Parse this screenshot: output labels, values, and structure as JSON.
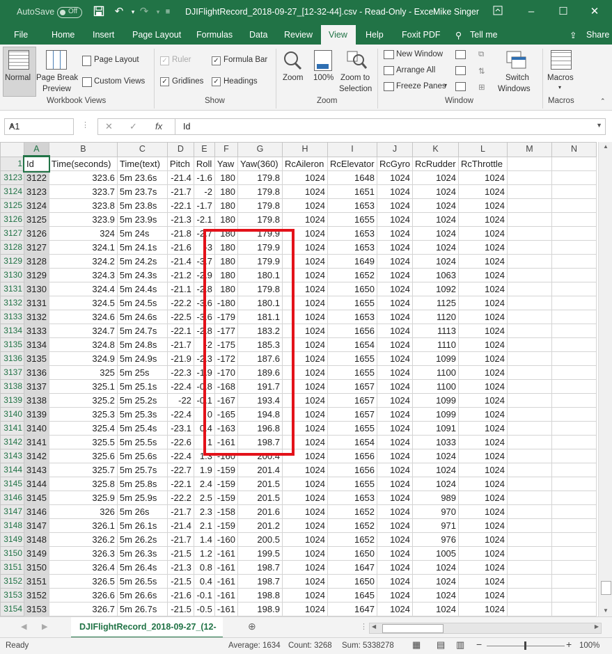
{
  "titlebar": {
    "autosave_label": "AutoSave",
    "autosave_state": "Off",
    "title": "DJIFlightRecord_2018-09-27_[12-32-44].csv  -  Read-Only  -  Excel",
    "user": "Mike Singer"
  },
  "menu": {
    "items": [
      "File",
      "Home",
      "Insert",
      "Page Layout",
      "Formulas",
      "Data",
      "Review",
      "View",
      "Help",
      "Foxit PDF"
    ],
    "tell_me": "Tell me",
    "share": "Share"
  },
  "ribbon": {
    "normal": "Normal",
    "page_break_1": "Page Break",
    "page_break_2": "Preview",
    "page_layout": "Page Layout",
    "custom_views": "Custom Views",
    "group_workbook_views": "Workbook Views",
    "ruler": "Ruler",
    "formula_bar": "Formula Bar",
    "gridlines": "Gridlines",
    "headings": "Headings",
    "group_show": "Show",
    "zoom": "Zoom",
    "zoom100": "100%",
    "zoom_sel_1": "Zoom to",
    "zoom_sel_2": "Selection",
    "group_zoom": "Zoom",
    "new_window": "New Window",
    "arrange_all": "Arrange All",
    "freeze_panes": "Freeze Panes",
    "switch_1": "Switch",
    "switch_2": "Windows",
    "group_window": "Window",
    "macros": "Macros",
    "group_macros": "Macros"
  },
  "formula_bar": {
    "name_box": "A1",
    "fx": "fx",
    "content": "Id"
  },
  "columns": [
    "A",
    "B",
    "C",
    "D",
    "E",
    "F",
    "G",
    "H",
    "I",
    "J",
    "K",
    "L",
    "M",
    "N"
  ],
  "header_row": {
    "row_number": "1",
    "cells": [
      "Id",
      "Time(seconds)",
      "Time(text)",
      "Pitch",
      "Roll",
      "Yaw",
      "Yaw(360)",
      "RcAileron",
      "RcElevator",
      "RcGyro",
      "RcRudder",
      "RcThrottle",
      "",
      ""
    ]
  },
  "rows": [
    [
      "3123",
      "3122",
      "323.6",
      "5m 23.6s",
      "-21.4",
      "-1.6",
      "180",
      "179.8",
      "1024",
      "1648",
      "1024",
      "1024",
      "1024"
    ],
    [
      "3124",
      "3123",
      "323.7",
      "5m 23.7s",
      "-21.7",
      "-2",
      "180",
      "179.8",
      "1024",
      "1651",
      "1024",
      "1024",
      "1024"
    ],
    [
      "3125",
      "3124",
      "323.8",
      "5m 23.8s",
      "-22.1",
      "-1.7",
      "180",
      "179.8",
      "1024",
      "1653",
      "1024",
      "1024",
      "1024"
    ],
    [
      "3126",
      "3125",
      "323.9",
      "5m 23.9s",
      "-21.3",
      "-2.1",
      "180",
      "179.8",
      "1024",
      "1655",
      "1024",
      "1024",
      "1024"
    ],
    [
      "3127",
      "3126",
      "324",
      "5m 24s",
      "-21.8",
      "-2.7",
      "180",
      "179.9",
      "1024",
      "1653",
      "1024",
      "1024",
      "1024"
    ],
    [
      "3128",
      "3127",
      "324.1",
      "5m 24.1s",
      "-21.6",
      "-3",
      "180",
      "179.9",
      "1024",
      "1653",
      "1024",
      "1024",
      "1024"
    ],
    [
      "3129",
      "3128",
      "324.2",
      "5m 24.2s",
      "-21.4",
      "-3.7",
      "180",
      "179.9",
      "1024",
      "1649",
      "1024",
      "1024",
      "1024"
    ],
    [
      "3130",
      "3129",
      "324.3",
      "5m 24.3s",
      "-21.2",
      "-2.9",
      "180",
      "180.1",
      "1024",
      "1652",
      "1024",
      "1063",
      "1024"
    ],
    [
      "3131",
      "3130",
      "324.4",
      "5m 24.4s",
      "-21.1",
      "-2.8",
      "180",
      "179.8",
      "1024",
      "1650",
      "1024",
      "1092",
      "1024"
    ],
    [
      "3132",
      "3131",
      "324.5",
      "5m 24.5s",
      "-22.2",
      "-3.6",
      "-180",
      "180.1",
      "1024",
      "1655",
      "1024",
      "1125",
      "1024"
    ],
    [
      "3133",
      "3132",
      "324.6",
      "5m 24.6s",
      "-22.5",
      "-3.6",
      "-179",
      "181.1",
      "1024",
      "1653",
      "1024",
      "1120",
      "1024"
    ],
    [
      "3134",
      "3133",
      "324.7",
      "5m 24.7s",
      "-22.1",
      "-2.8",
      "-177",
      "183.2",
      "1024",
      "1656",
      "1024",
      "1113",
      "1024"
    ],
    [
      "3135",
      "3134",
      "324.8",
      "5m 24.8s",
      "-21.7",
      "-2",
      "-175",
      "185.3",
      "1024",
      "1654",
      "1024",
      "1110",
      "1024"
    ],
    [
      "3136",
      "3135",
      "324.9",
      "5m 24.9s",
      "-21.9",
      "-2.3",
      "-172",
      "187.6",
      "1024",
      "1655",
      "1024",
      "1099",
      "1024"
    ],
    [
      "3137",
      "3136",
      "325",
      "5m 25s",
      "-22.3",
      "-1.9",
      "-170",
      "189.6",
      "1024",
      "1655",
      "1024",
      "1100",
      "1024"
    ],
    [
      "3138",
      "3137",
      "325.1",
      "5m 25.1s",
      "-22.4",
      "-0.8",
      "-168",
      "191.7",
      "1024",
      "1657",
      "1024",
      "1100",
      "1024"
    ],
    [
      "3139",
      "3138",
      "325.2",
      "5m 25.2s",
      "-22",
      "-0.1",
      "-167",
      "193.4",
      "1024",
      "1657",
      "1024",
      "1099",
      "1024"
    ],
    [
      "3140",
      "3139",
      "325.3",
      "5m 25.3s",
      "-22.4",
      "0",
      "-165",
      "194.8",
      "1024",
      "1657",
      "1024",
      "1099",
      "1024"
    ],
    [
      "3141",
      "3140",
      "325.4",
      "5m 25.4s",
      "-23.1",
      "0.4",
      "-163",
      "196.8",
      "1024",
      "1655",
      "1024",
      "1091",
      "1024"
    ],
    [
      "3142",
      "3141",
      "325.5",
      "5m 25.5s",
      "-22.6",
      "1",
      "-161",
      "198.7",
      "1024",
      "1654",
      "1024",
      "1033",
      "1024"
    ],
    [
      "3143",
      "3142",
      "325.6",
      "5m 25.6s",
      "-22.4",
      "1.3",
      "-160",
      "200.4",
      "1024",
      "1656",
      "1024",
      "1024",
      "1024"
    ],
    [
      "3144",
      "3143",
      "325.7",
      "5m 25.7s",
      "-22.7",
      "1.9",
      "-159",
      "201.4",
      "1024",
      "1656",
      "1024",
      "1024",
      "1024"
    ],
    [
      "3145",
      "3144",
      "325.8",
      "5m 25.8s",
      "-22.1",
      "2.4",
      "-159",
      "201.5",
      "1024",
      "1655",
      "1024",
      "1024",
      "1024"
    ],
    [
      "3146",
      "3145",
      "325.9",
      "5m 25.9s",
      "-22.2",
      "2.5",
      "-159",
      "201.5",
      "1024",
      "1653",
      "1024",
      "989",
      "1024"
    ],
    [
      "3147",
      "3146",
      "326",
      "5m 26s",
      "-21.7",
      "2.3",
      "-158",
      "201.6",
      "1024",
      "1652",
      "1024",
      "970",
      "1024"
    ],
    [
      "3148",
      "3147",
      "326.1",
      "5m 26.1s",
      "-21.4",
      "2.1",
      "-159",
      "201.2",
      "1024",
      "1652",
      "1024",
      "971",
      "1024"
    ],
    [
      "3149",
      "3148",
      "326.2",
      "5m 26.2s",
      "-21.7",
      "1.4",
      "-160",
      "200.5",
      "1024",
      "1652",
      "1024",
      "976",
      "1024"
    ],
    [
      "3150",
      "3149",
      "326.3",
      "5m 26.3s",
      "-21.5",
      "1.2",
      "-161",
      "199.5",
      "1024",
      "1650",
      "1024",
      "1005",
      "1024"
    ],
    [
      "3151",
      "3150",
      "326.4",
      "5m 26.4s",
      "-21.3",
      "0.8",
      "-161",
      "198.7",
      "1024",
      "1647",
      "1024",
      "1024",
      "1024"
    ],
    [
      "3152",
      "3151",
      "326.5",
      "5m 26.5s",
      "-21.5",
      "0.4",
      "-161",
      "198.7",
      "1024",
      "1650",
      "1024",
      "1024",
      "1024"
    ],
    [
      "3153",
      "3152",
      "326.6",
      "5m 26.6s",
      "-21.6",
      "-0.1",
      "-161",
      "198.8",
      "1024",
      "1645",
      "1024",
      "1024",
      "1024"
    ],
    [
      "3154",
      "3153",
      "326.7",
      "5m 26.7s",
      "-21.5",
      "-0.5",
      "-161",
      "198.9",
      "1024",
      "1647",
      "1024",
      "1024",
      "1024"
    ]
  ],
  "sheet_tab": "DJIFlightRecord_2018-09-27_(12-",
  "status": {
    "ready": "Ready",
    "average": "Average: 1634",
    "count": "Count: 3268",
    "sum": "Sum: 5338278",
    "zoom": "100%"
  },
  "colors": {
    "excel_green": "#217346",
    "highlight_red": "#e3121a"
  }
}
